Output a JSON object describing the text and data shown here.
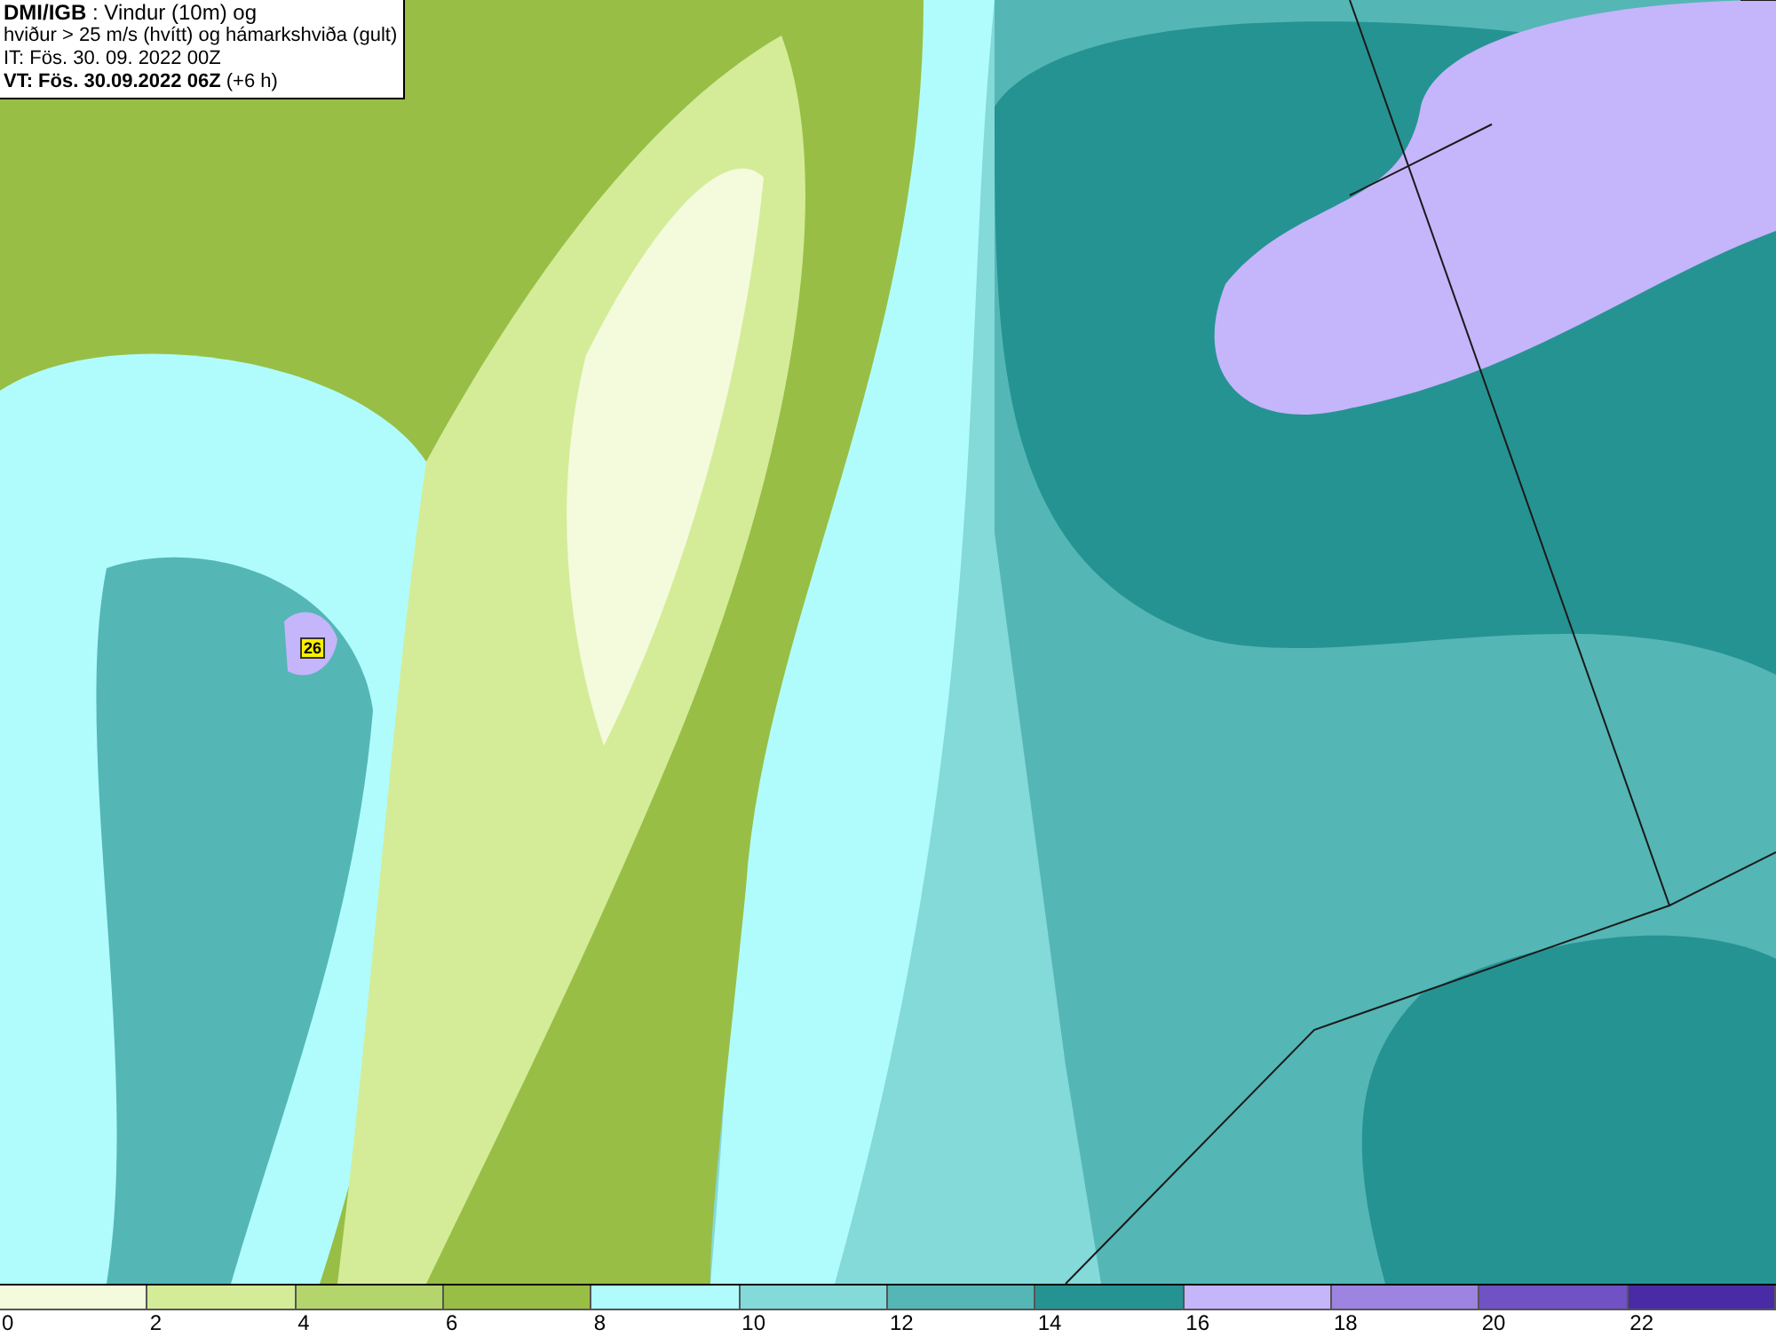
{
  "header": {
    "lines": [
      "**DMI/IGB** : Vindur (10m) og",
      "hviður > 25 m/s (hvítt) og hámarkshviða (gult)",
      "IT: Fös. 30. 09. 2022 00Z",
      "**VT: Fös. 30.09.2022 06Z** (+6 h)"
    ]
  },
  "map": {
    "gust_marker": "26"
  },
  "legend": [
    {
      "label": "0",
      "color": "#f4fbdc"
    },
    {
      "label": "2",
      "color": "#d4ec98"
    },
    {
      "label": "4",
      "color": "#b4d56c"
    },
    {
      "label": "6",
      "color": "#98be46"
    },
    {
      "label": "8",
      "color": "#b0fcfc"
    },
    {
      "label": "10",
      "color": "#84d9d9"
    },
    {
      "label": "12",
      "color": "#55b6b6"
    },
    {
      "label": "14",
      "color": "#269393"
    },
    {
      "label": "16",
      "color": "#c5b5fb"
    },
    {
      "label": "18",
      "color": "#9c84e0"
    },
    {
      "label": "20",
      "color": "#7052c4"
    },
    {
      "label": "22",
      "color": "#4a2ba6"
    }
  ]
}
